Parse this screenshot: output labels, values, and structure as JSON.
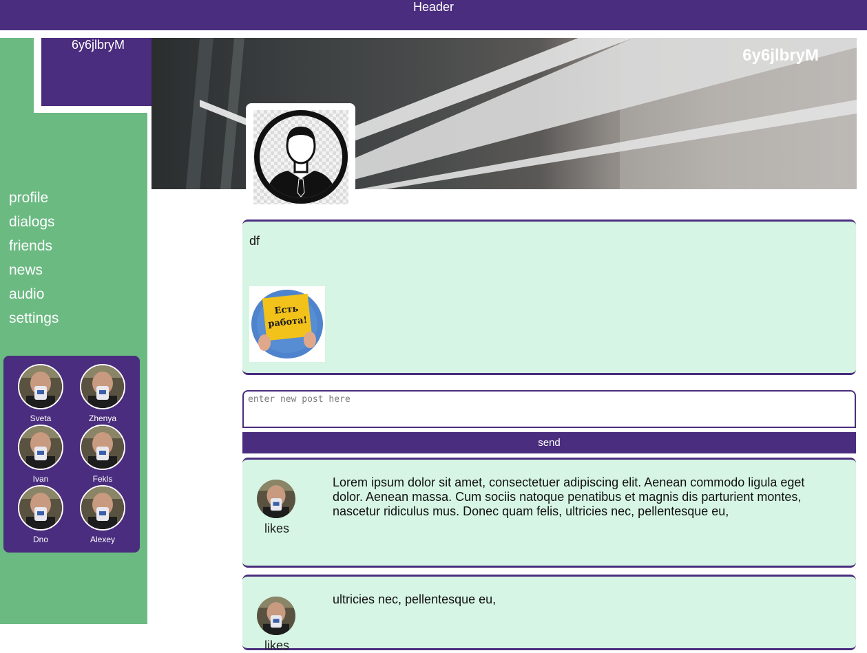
{
  "header": {
    "title": "Header"
  },
  "sidebar": {
    "logo_text": "6y6jlbryM",
    "nav": [
      "profile",
      "dialogs",
      "friends",
      "news",
      "audio",
      "settings"
    ],
    "friends": [
      "Sveta",
      "Zhenya",
      "Ivan",
      "Fekls",
      "Dno",
      "Alexey"
    ]
  },
  "profile": {
    "banner_name": "6y6jlbryM",
    "status": "df",
    "image_caption_1": "Есть",
    "image_caption_2": "работа!"
  },
  "new_post": {
    "placeholder": "enter new post here",
    "send_label": "send"
  },
  "posts": [
    {
      "text": "Lorem ipsum dolor sit amet, consectetuer adipiscing elit. Aenean commodo ligula eget dolor. Aenean massa. Cum sociis natoque penatibus et magnis dis parturient montes, nascetur ridiculus mus. Donec quam felis, ultricies nec, pellentesque eu,",
      "likes_label": "likes"
    },
    {
      "text": "ultricies nec, pellentesque eu,",
      "likes_label": "likes"
    }
  ],
  "colors": {
    "brand_purple": "#4a2d7e",
    "sidebar_green": "#6bba82",
    "card_mint": "#d6f5e4"
  },
  "icons": {
    "profile_avatar": "user-silhouette-icon",
    "friend_avatar": "person-with-mug-photo"
  }
}
